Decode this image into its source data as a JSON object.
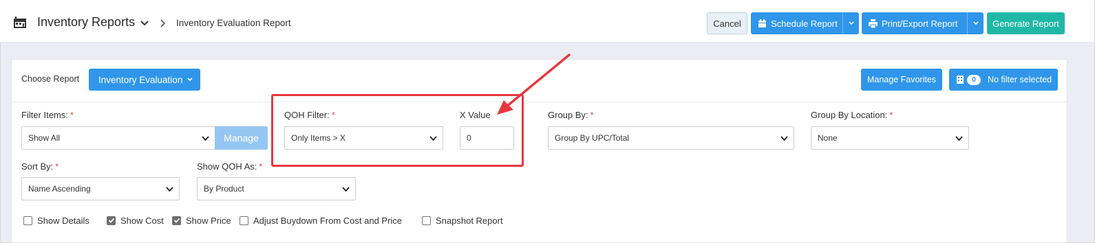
{
  "header": {
    "title": "Inventory Reports",
    "breadcrumb": "Inventory Evaluation Report",
    "cancel_label": "Cancel",
    "schedule_label": "Schedule Report",
    "print_label": "Print/Export Report",
    "generate_label": "Generate Report"
  },
  "report": {
    "choose_label": "Choose Report",
    "selected_report": "Inventory Evaluation",
    "manage_favorites_label": "Manage Favorites",
    "filter_count": "0",
    "filter_status": "No filter selected"
  },
  "filters": {
    "filter_items": {
      "label": "Filter Items:",
      "required": "*",
      "value": "Show All",
      "manage_label": "Manage"
    },
    "qoh_filter": {
      "label": "QOH Filter:",
      "required": "*",
      "value": "Only Items > X"
    },
    "x_value": {
      "label": "X Value",
      "value": "0"
    },
    "group_by": {
      "label": "Group By:",
      "required": "*",
      "value": "Group By UPC/Total"
    },
    "group_by_location": {
      "label": "Group By Location:",
      "required": "*",
      "value": "None"
    },
    "sort_by": {
      "label": "Sort By:",
      "required": "*",
      "value": "Name Ascending"
    },
    "show_qoh_as": {
      "label": "Show QOH As:",
      "required": "*",
      "value": "By Product"
    }
  },
  "options": [
    {
      "label": "Show Details",
      "checked": false
    },
    {
      "label": "Show Cost",
      "checked": true
    },
    {
      "label": "Show Price",
      "checked": true
    },
    {
      "label": "Adjust Buydown From Cost and Price",
      "checked": false
    },
    {
      "label": "Snapshot Report",
      "checked": false
    }
  ],
  "colors": {
    "primary": "#2f96ea",
    "teal": "#1fb8a6",
    "required": "#e0434b",
    "annotation": "#e8383f",
    "body_bg": "#ececf4"
  },
  "icons": [
    "store-icon",
    "chevron-down-icon",
    "chevron-right-icon",
    "calendar-icon",
    "printer-icon",
    "filter-icon"
  ]
}
